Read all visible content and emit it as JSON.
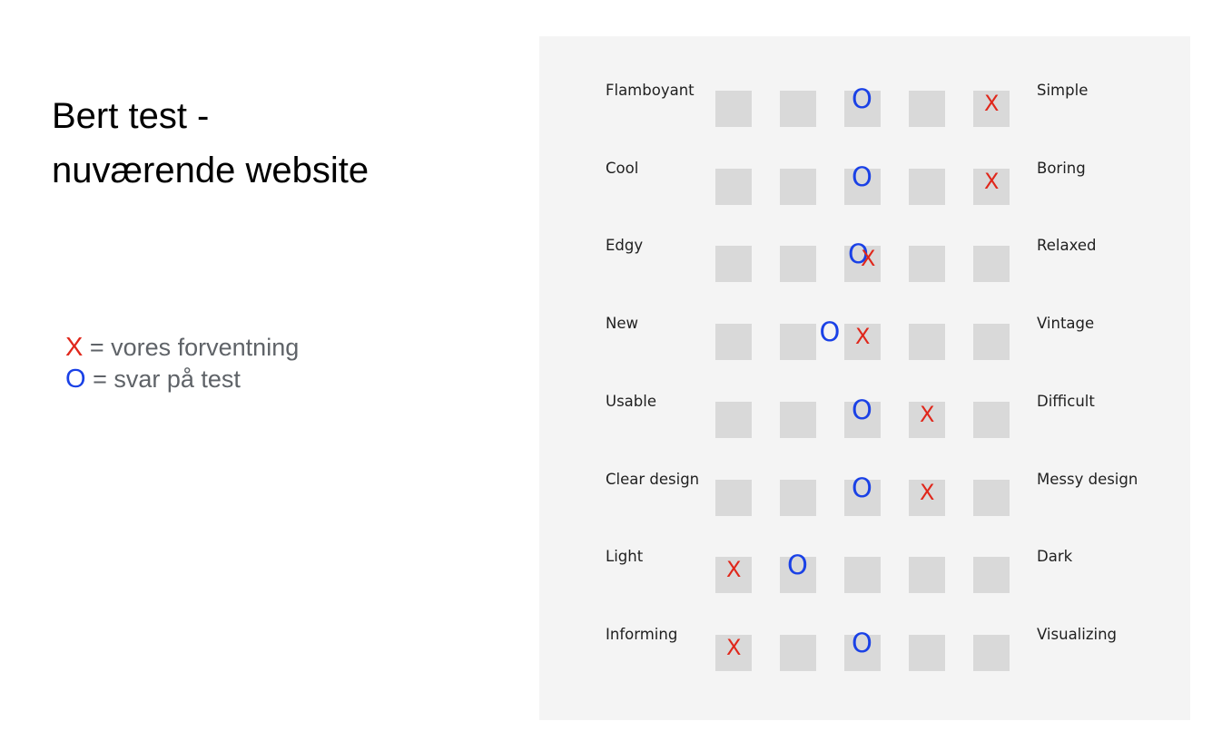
{
  "title": {
    "line1": "Bert test -",
    "line2": "nuværende website"
  },
  "legend": {
    "x_symbol": "X",
    "x_text": " = vores forventning",
    "o_symbol": "O",
    "o_text": " = svar på test"
  },
  "colors": {
    "x_mark": "#e0271b",
    "o_mark": "#1a41e6",
    "cell": "#d9d9d9",
    "panel": "#f4f4f4"
  },
  "scale": {
    "positions": 5,
    "rows": [
      {
        "left": "Flamboyant",
        "right": "Simple",
        "o": 3,
        "x": 5
      },
      {
        "left": "Cool",
        "right": "Boring",
        "o": 3,
        "x": 5
      },
      {
        "left": "Edgy",
        "right": "Relaxed",
        "o": 3,
        "x": 3
      },
      {
        "left": "New",
        "right": "Vintage",
        "o": 2.5,
        "x": 3
      },
      {
        "left": "Usable",
        "right": "Difficult",
        "o": 3,
        "x": 4
      },
      {
        "left": "Clear design",
        "right": "Messy design",
        "o": 3,
        "x": 4
      },
      {
        "left": "Light",
        "right": "Dark",
        "o": 2,
        "x": 1
      },
      {
        "left": "Informing",
        "right": "Visualizing",
        "o": 3,
        "x": 1
      }
    ]
  }
}
